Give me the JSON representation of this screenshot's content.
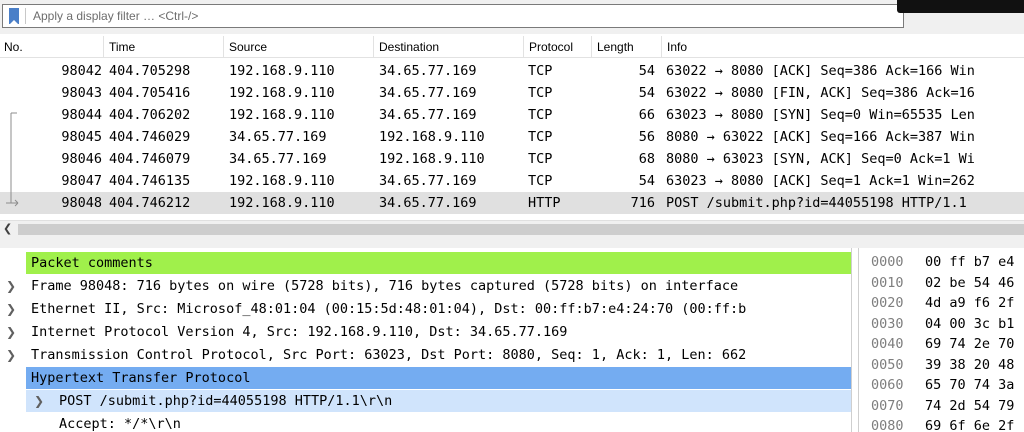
{
  "filter": {
    "placeholder": "Apply a display filter … <Ctrl-/>",
    "icon": "bookmark-icon"
  },
  "columns": [
    "No.",
    "Time",
    "Source",
    "Destination",
    "Protocol",
    "Length",
    "Info"
  ],
  "packets": [
    {
      "no": "98042",
      "time": "404.705298",
      "source": "192.168.9.110",
      "destination": "34.65.77.169",
      "protocol": "TCP",
      "length": "54",
      "info": "63022 → 8080 [ACK] Seq=386 Ack=166 Win"
    },
    {
      "no": "98043",
      "time": "404.705416",
      "source": "192.168.9.110",
      "destination": "34.65.77.169",
      "protocol": "TCP",
      "length": "54",
      "info": "63022 → 8080 [FIN, ACK] Seq=386 Ack=16"
    },
    {
      "no": "98044",
      "time": "404.706202",
      "source": "192.168.9.110",
      "destination": "34.65.77.169",
      "protocol": "TCP",
      "length": "66",
      "info": "63023 → 8080 [SYN] Seq=0 Win=65535 Len"
    },
    {
      "no": "98045",
      "time": "404.746029",
      "source": "34.65.77.169",
      "destination": "192.168.9.110",
      "protocol": "TCP",
      "length": "56",
      "info": "8080 → 63022 [ACK] Seq=166 Ack=387 Win"
    },
    {
      "no": "98046",
      "time": "404.746079",
      "source": "34.65.77.169",
      "destination": "192.168.9.110",
      "protocol": "TCP",
      "length": "68",
      "info": "8080 → 63023 [SYN, ACK] Seq=0 Ack=1 Wi"
    },
    {
      "no": "98047",
      "time": "404.746135",
      "source": "192.168.9.110",
      "destination": "34.65.77.169",
      "protocol": "TCP",
      "length": "54",
      "info": "63023 → 8080 [ACK] Seq=1 Ack=1 Win=262"
    },
    {
      "no": "98048",
      "time": "404.746212",
      "source": "192.168.9.110",
      "destination": "34.65.77.169",
      "protocol": "HTTP",
      "length": "716",
      "info": "POST /submit.php?id=44055198 HTTP/1.1"
    }
  ],
  "selected_packet": "98048",
  "details": [
    {
      "text": "Packet comments",
      "state": "collapsed",
      "style": "comment"
    },
    {
      "text": "Frame 98048: 716 bytes on wire (5728 bits), 716 bytes captured (5728 bits) on interface",
      "state": "collapsed",
      "style": "normal"
    },
    {
      "text": "Ethernet II, Src: Microsof_48:01:04 (00:15:5d:48:01:04), Dst: 00:ff:b7:e4:24:70 (00:ff:b",
      "state": "collapsed",
      "style": "normal"
    },
    {
      "text": "Internet Protocol Version 4, Src: 192.168.9.110, Dst: 34.65.77.169",
      "state": "collapsed",
      "style": "normal"
    },
    {
      "text": "Transmission Control Protocol, Src Port: 63023, Dst Port: 8080, Seq: 1, Ack: 1, Len: 662",
      "state": "collapsed",
      "style": "normal"
    },
    {
      "text": "Hypertext Transfer Protocol",
      "state": "expanded",
      "style": "http"
    },
    {
      "text": "POST /submit.php?id=44055198 HTTP/1.1\\r\\n",
      "state": "collapsed",
      "style": "sub-selected"
    },
    {
      "text": "Accept: */*\\r\\n",
      "state": "leaf",
      "style": "normal"
    }
  ],
  "hex": [
    {
      "offset": "0000",
      "bytes": "00 ff b7 e4"
    },
    {
      "offset": "0010",
      "bytes": "02 be 54 46"
    },
    {
      "offset": "0020",
      "bytes": "4d a9 f6 2f"
    },
    {
      "offset": "0030",
      "bytes": "04 00 3c b1"
    },
    {
      "offset": "0040",
      "bytes": "69 74 2e 70"
    },
    {
      "offset": "0050",
      "bytes": "39 38 20 48"
    },
    {
      "offset": "0060",
      "bytes": "65 70 74 3a"
    },
    {
      "offset": "0070",
      "bytes": "74 2d 54 79"
    },
    {
      "offset": "0080",
      "bytes": "69 6f 6e 2f"
    }
  ],
  "colors": {
    "comment_bg": "#a0f04b",
    "http_bg": "#74acf1",
    "selected_row_bg": "#e0e0e0",
    "bookmark": "#4a7fc8"
  }
}
